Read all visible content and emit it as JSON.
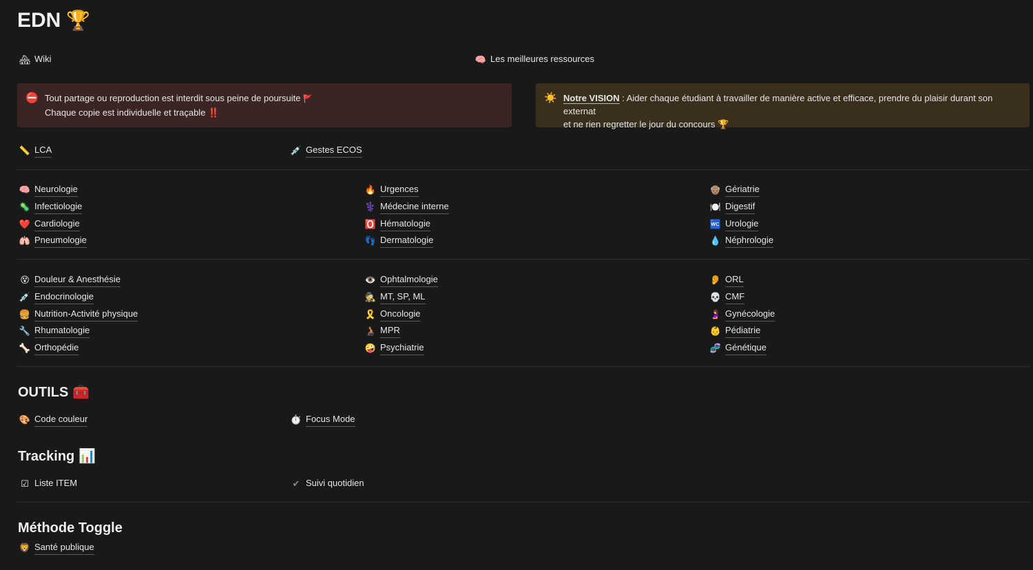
{
  "title": {
    "text": "EDN",
    "icon": "🏆"
  },
  "top_links": {
    "wiki": {
      "icon": "🏘",
      "label": "Wiki"
    },
    "ressources": {
      "icon": "🧠",
      "label": "Les meilleures ressources"
    }
  },
  "callouts": {
    "warning": {
      "icon": "⛔",
      "line1": "Tout partage ou reproduction est interdit sous peine de poursuite",
      "line1_icon": "🚩",
      "line2": "Chaque copie est individuelle et traçable",
      "line2_icon": "‼️"
    },
    "vision": {
      "icon": "☀️",
      "bold": "Notre VISION",
      "text1": " : Aider chaque étudiant à travailler de manière active et efficace, prendre du plaisir durant son externat",
      "text2": "et ne rien regretter le jour du concours",
      "text2_icon": "🏆"
    }
  },
  "row1": [
    {
      "icon": "📏",
      "label": "LCA"
    },
    {
      "icon": "💉",
      "label": "Gestes ECOS"
    }
  ],
  "specialties_a": {
    "col1": [
      {
        "icon": "🧠",
        "label": "Neurologie"
      },
      {
        "icon": "🦠",
        "label": "Infectiologie"
      },
      {
        "icon": "❤️",
        "label": "Cardiologie"
      },
      {
        "icon": "🫁",
        "label": "Pneumologie"
      }
    ],
    "col2": [
      {
        "icon": "🔥",
        "label": "Urgences"
      },
      {
        "icon": "⚕️",
        "label": "Médecine interne"
      },
      {
        "icon": "🅾️",
        "label": "Hématologie"
      },
      {
        "icon": "👣",
        "label": "Dermatologie"
      }
    ],
    "col3": [
      {
        "icon": "👴🏽",
        "label": "Gériatrie"
      },
      {
        "icon": "🍽️",
        "label": "Digestif"
      },
      {
        "icon": "🚾",
        "label": "Urologie"
      },
      {
        "icon": "💧",
        "label": "Néphrologie"
      }
    ]
  },
  "specialties_b": {
    "col1": [
      {
        "icon": "😵",
        "label": "Douleur & Anesthésie"
      },
      {
        "icon": "💉",
        "label": "Endocrinologie"
      },
      {
        "icon": "🍔",
        "label": "Nutrition-Activité physique"
      },
      {
        "icon": "🔧",
        "label": "Rhumatologie"
      },
      {
        "icon": "🦴",
        "label": "Orthopédie"
      }
    ],
    "col2": [
      {
        "icon": "👁️",
        "label": "Ophtalmologie"
      },
      {
        "icon": "🕵️",
        "label": "MT, SP, ML"
      },
      {
        "icon": "🎗️",
        "label": "Oncologie"
      },
      {
        "icon": "🧑‍🦽",
        "label": "MPR"
      },
      {
        "icon": "🤪",
        "label": "Psychiatrie"
      }
    ],
    "col3": [
      {
        "icon": "👂",
        "label": "ORL"
      },
      {
        "icon": "💀",
        "label": "CMF"
      },
      {
        "icon": "🤰",
        "label": "Gynécologie"
      },
      {
        "icon": "👶",
        "label": "Pédiatrie"
      },
      {
        "icon": "🧬",
        "label": "Génétique"
      }
    ]
  },
  "outils": {
    "heading": "OUTILS",
    "heading_icon": "🧰",
    "items": [
      {
        "icon": "🎨",
        "label": "Code couleur"
      },
      {
        "icon": "⏱️",
        "label": "Focus Mode"
      }
    ]
  },
  "tracking": {
    "heading": "Tracking",
    "heading_icon": "📊",
    "items": [
      {
        "icon": "☑",
        "label": "Liste ITEM"
      },
      {
        "icon": "✔",
        "label": "Suivi quotidien"
      }
    ]
  },
  "methode": {
    "heading": "Méthode Toggle",
    "items": [
      {
        "icon": "🦁",
        "label": "Santé publique"
      }
    ]
  }
}
